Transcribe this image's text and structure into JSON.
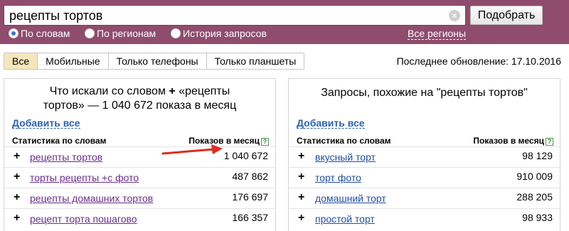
{
  "search": {
    "query": "рецепты тортов",
    "button_label": "Подобрать"
  },
  "modes": [
    {
      "label": "По словам",
      "selected": true
    },
    {
      "label": "По регионам",
      "selected": false
    },
    {
      "label": "История запросов",
      "selected": false
    }
  ],
  "regions_link": "Все регионы",
  "tabs": [
    {
      "label": "Все",
      "active": true
    },
    {
      "label": "Мобильные",
      "active": false
    },
    {
      "label": "Только телефоны",
      "active": false
    },
    {
      "label": "Только планшеты",
      "active": false
    }
  ],
  "last_update": "Последнее обновление: 17.10.2016",
  "left_panel": {
    "title_line1_a": "Что искали со словом",
    "title_line1_b": "«рецепты",
    "title_line2": "тортов» — 1 040 672 показа в месяц",
    "add_all": "Добавить все",
    "col_phrase": "Статистика по словам",
    "col_count": "Показов в месяц",
    "rows": [
      {
        "phrase": "рецепты тортов",
        "count": "1 040 672"
      },
      {
        "phrase": "торты рецепты +с фото",
        "count": "487 862"
      },
      {
        "phrase": "рецепты домашних тортов",
        "count": "176 697"
      },
      {
        "phrase": "рецепт торта пошагово",
        "count": "166 357"
      }
    ]
  },
  "right_panel": {
    "title": "Запросы, похожие на \"рецепты тортов\"",
    "add_all": "Добавить все",
    "col_phrase": "Статистика по словам",
    "col_count": "Показов в месяц",
    "rows": [
      {
        "phrase": "вкусный торт",
        "count": "98 129"
      },
      {
        "phrase": "торт фото",
        "count": "910 009"
      },
      {
        "phrase": "домашний торт",
        "count": "288 205"
      },
      {
        "phrase": "простой торт",
        "count": "98 933"
      }
    ]
  },
  "colors": {
    "band": "#8f4c6c",
    "active_tab": "#f7e6bb",
    "link_visited": "#6b2b8f",
    "link": "#1f4fa8",
    "arrow": "#e02b20"
  },
  "icons": {
    "clear": "clear-icon",
    "help": "help-icon",
    "plus": "plus-icon",
    "arrow": "red-arrow-annotation"
  }
}
